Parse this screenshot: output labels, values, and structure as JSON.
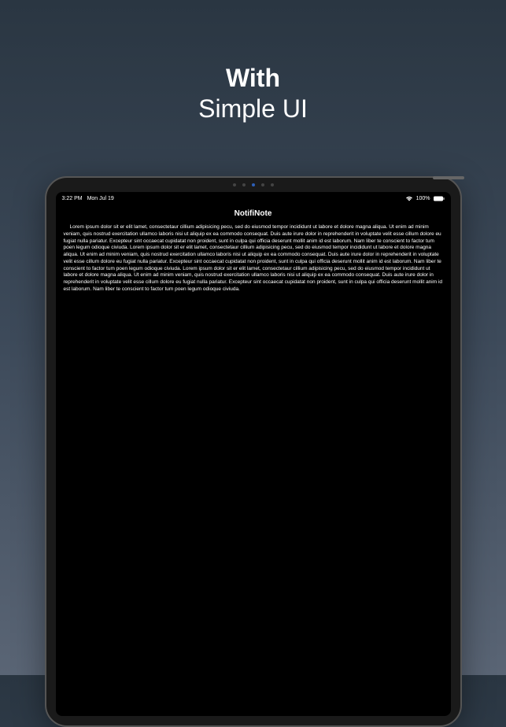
{
  "marketing": {
    "title": "With",
    "subtitle": "Simple UI"
  },
  "statusBar": {
    "time": "3:22 PM",
    "date": "Mon Jul 19",
    "batteryPercent": "100%"
  },
  "app": {
    "title": "NotifiNote",
    "noteText": "Lorem ipsum dolor sit er elit lamet, consectetaur cillium adipisicing pecu, sed do eiusmod tempor incididunt ut labore et dolore magna aliqua. Ut enim ad minim veniam, quis nostrud exercitation ullamco laboris nisi ut aliquip ex ea commodo consequat. Duis aute irure dolor in reprehenderit in voluptate velit esse cillum dolore eu fugiat nulla pariatur. Excepteur sint occaecat cupidatat non proident, sunt in culpa qui officia deserunt mollit anim id est laborum. Nam liber te conscient to factor tum poen legum odioque civiuda. Lorem ipsum dolor sit er elit lamet, consectetaur cillium adipisicing pecu, sed do eiusmod tempor incididunt ut labore et dolore magna aliqua. Ut enim ad minim veniam, quis nostrud exercitation ullamco laboris nisi ut aliquip ex ea commodo consequat. Duis aute irure dolor in reprehenderit in voluptate velit esse cillum dolore eu fugiat nulla pariatur. Excepteur sint occaecat cupidatat non proident, sunt in culpa qui officia deserunt mollit anim id est laborum. Nam liber te conscient to factor tum poen legum odioque civiuda. Lorem ipsum dolor sit er elit lamet, consectetaur cillium adipisicing pecu, sed do eiusmod tempor incididunt ut labore et dolore magna aliqua. Ut enim ad minim veniam, quis nostrud exercitation ullamco laboris nisi ut aliquip ex ea commodo consequat. Duis aute irure dolor in reprehenderit in voluptate velit esse cillum dolore eu fugiat nulla pariatur. Excepteur sint occaecat cupidatat non proident, sunt in culpa qui officia deserunt mollit anim id est laborum. Nam liber te conscient to factor tum poen legum odioque civiuda."
  }
}
